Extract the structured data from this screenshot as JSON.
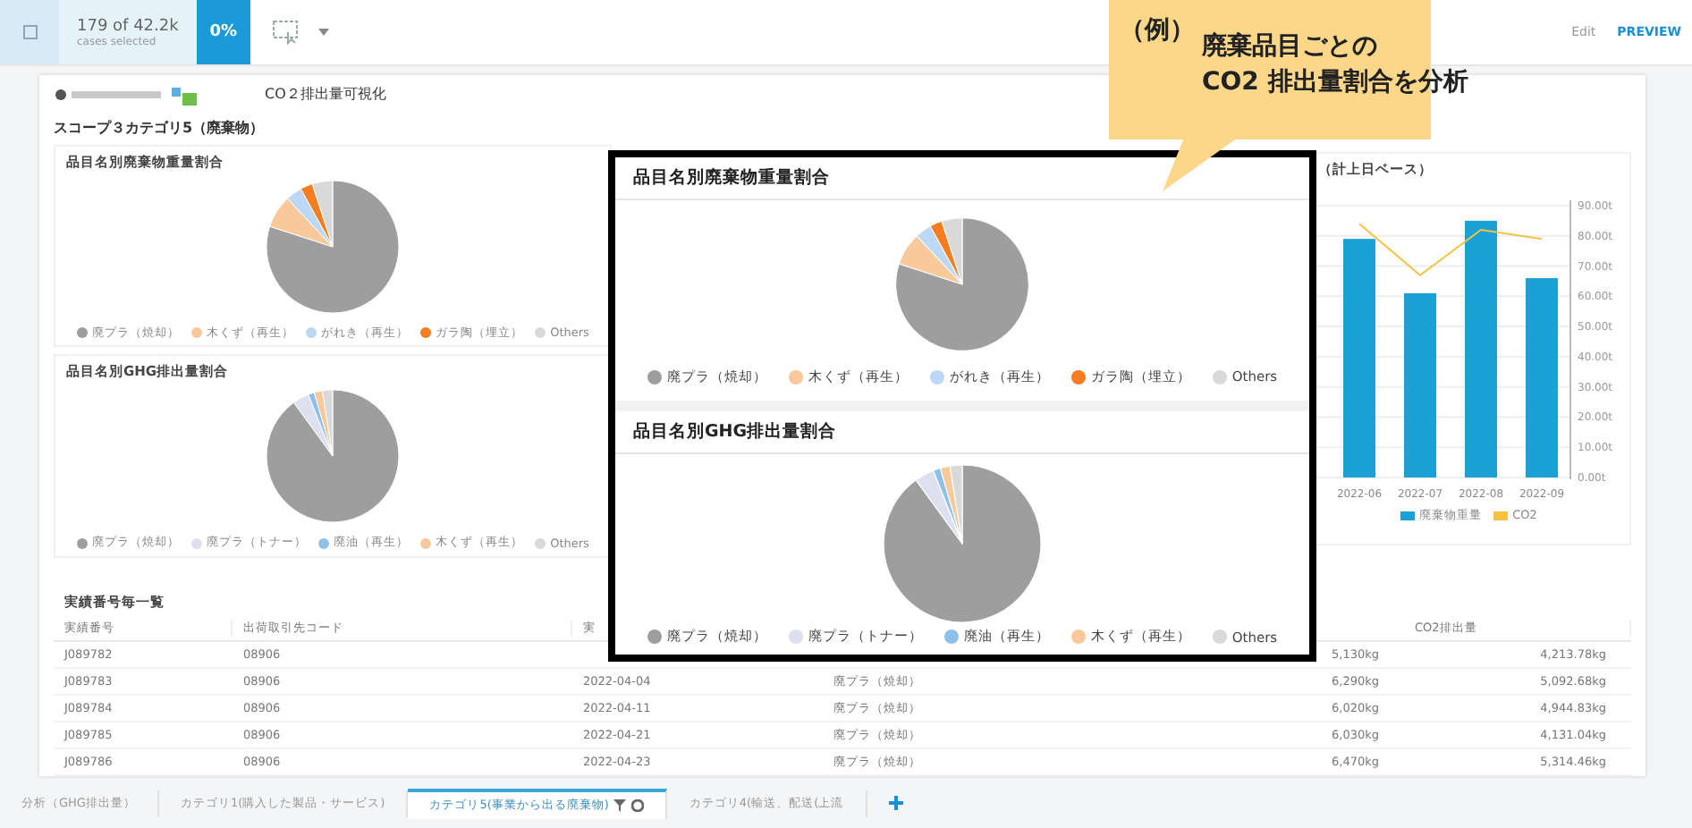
{
  "toolbar": {
    "count": "179 of 42.2k",
    "count_caption": "cases selected",
    "percent": "0%",
    "edit": "Edit",
    "preview": "PREVIEW"
  },
  "callout": {
    "prefix": "（例）",
    "lines": [
      "廃棄品目ごとの",
      "CO2 排出量割合を分析"
    ]
  },
  "header": {
    "title": "CO２排出量可視化"
  },
  "section_title": "スコープ３カテゴリ5（廃棄物）",
  "background_panels": [
    {
      "title": "品目名別廃棄物重量割合",
      "legend": [
        {
          "label": "廃プラ（焼却）",
          "color": "#9e9e9e"
        },
        {
          "label": "木くず（再生）",
          "color": "#f9c89b"
        },
        {
          "label": "がれき（再生）",
          "color": "#bcd8f5"
        },
        {
          "label": "ガラ陶（埋立）",
          "color": "#f57c1f"
        },
        {
          "label": "Others",
          "color": "#d9d9d9"
        }
      ]
    },
    {
      "title": "品目名別GHG排出量割合",
      "legend": [
        {
          "label": "廃プラ（焼却）",
          "color": "#9e9e9e"
        },
        {
          "label": "廃プラ（トナー）",
          "color": "#dde0ee"
        },
        {
          "label": "廃油（再生）",
          "color": "#8ec1ea"
        },
        {
          "label": "木くず（再生）",
          "color": "#f9c89b"
        },
        {
          "label": "Others",
          "color": "#d9d9d9"
        }
      ]
    }
  ],
  "trend_panel": {
    "title": "（計上日ベース）",
    "chart_data": {
      "type": "bar",
      "grid": true,
      "categories": [
        "2022-06",
        "2022-07",
        "2022-08",
        "2022-09"
      ],
      "series": [
        {
          "name": "廃棄物重量",
          "color": "#1ba1d6",
          "values": [
            79,
            61,
            85,
            66
          ]
        },
        {
          "name": "CO2",
          "color": "#f5c242",
          "type": "line",
          "values": [
            84,
            67,
            82,
            79
          ]
        }
      ],
      "ylim": [
        0,
        90
      ],
      "yticks": [
        {
          "value": 0,
          "label": "0.00t"
        },
        {
          "value": 10,
          "label": "10.00t"
        },
        {
          "value": 20,
          "label": "20.00t"
        },
        {
          "value": 30,
          "label": "30.00t"
        },
        {
          "value": 40,
          "label": "40.00t"
        },
        {
          "value": 50,
          "label": "50.00t"
        },
        {
          "value": 60,
          "label": "60.00t"
        },
        {
          "value": 70,
          "label": "70.00t"
        },
        {
          "value": 80,
          "label": "80.00t"
        },
        {
          "value": 90,
          "label": "90.00t"
        }
      ]
    }
  },
  "table": {
    "title": "実績番号毎一覧",
    "columns": [
      "実績番号",
      "出荷取引先コード",
      "実",
      null,
      null,
      "CO2排出量"
    ],
    "rows": [
      [
        "J089782",
        "08906",
        null,
        null,
        "5,130kg",
        "4,213.78kg"
      ],
      [
        "J089783",
        "08906",
        "2022-04-04",
        "廃プラ（焼却）",
        "6,290kg",
        "5,092.68kg"
      ],
      [
        "J089784",
        "08906",
        "2022-04-11",
        "廃プラ（焼却）",
        "6,020kg",
        "4,944.83kg"
      ],
      [
        "J089785",
        "08906",
        "2022-04-21",
        "廃プラ（焼却）",
        "6,030kg",
        "4,131.04kg"
      ],
      [
        "J089786",
        "08906",
        "2022-04-23",
        "廃プラ（焼却）",
        "6,470kg",
        "5,314.46kg"
      ]
    ]
  },
  "inset_panels": [
    {
      "title": "品目名別廃棄物重量割合",
      "legend": [
        {
          "label": "廃プラ（焼却）",
          "color": "#9e9e9e"
        },
        {
          "label": "木くず（再生）",
          "color": "#f9c89b"
        },
        {
          "label": "がれき（再生）",
          "color": "#bcd8f5"
        },
        {
          "label": "ガラ陶（埋立）",
          "color": "#f57c1f"
        },
        {
          "label": "Others",
          "color": "#d9d9d9"
        }
      ]
    },
    {
      "title": "品目名別GHG排出量割合",
      "legend": [
        {
          "label": "廃プラ（焼却）",
          "color": "#9e9e9e"
        },
        {
          "label": "廃プラ（トナー）",
          "color": "#dde0ee"
        },
        {
          "label": "廃油（再生）",
          "color": "#8ec1ea"
        },
        {
          "label": "木くず（再生）",
          "color": "#f9c89b"
        },
        {
          "label": "Others",
          "color": "#d9d9d9"
        }
      ]
    }
  ],
  "tabs": [
    {
      "label": "分析（GHG排出量）",
      "selected": false
    },
    {
      "label": "カテゴリ1(購入した製品・サービス)",
      "selected": false
    },
    {
      "label": "カテゴリ5(事業から出る廃棄物)",
      "selected": true
    },
    {
      "label": "カテゴリ4(輸送、配送(上流",
      "selected": false
    }
  ]
}
